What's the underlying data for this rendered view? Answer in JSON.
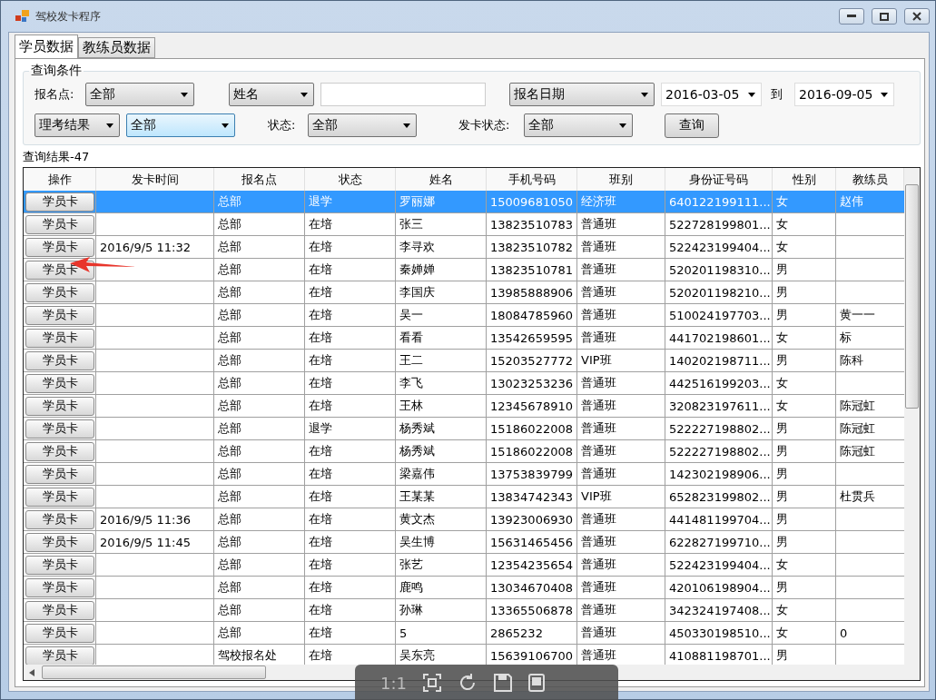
{
  "window": {
    "title": "驾校发卡程序"
  },
  "tabs": [
    {
      "label": "学员数据",
      "selected": true
    },
    {
      "label": "教练员数据",
      "selected": false
    }
  ],
  "query": {
    "title": "查询条件",
    "row1": [
      {
        "kind": "label",
        "text": "报名点:"
      },
      {
        "kind": "combo",
        "value": "全部",
        "focused": false
      },
      {
        "kind": "combo",
        "value": "姓名",
        "focused": false
      },
      {
        "kind": "field"
      },
      {
        "kind": "combo",
        "value": "报名日期",
        "focused": false
      },
      {
        "kind": "date",
        "value": "2016-03-05"
      },
      {
        "kind": "label",
        "text": "到"
      },
      {
        "kind": "date",
        "value": "2016-09-05"
      }
    ],
    "row2": [
      {
        "kind": "combo",
        "value": "理考结果",
        "focused": false
      },
      {
        "kind": "combo",
        "value": "全部",
        "focused": true
      },
      {
        "kind": "label",
        "text": "状态:"
      },
      {
        "kind": "combo",
        "value": "全部",
        "focused": false
      },
      {
        "kind": "label",
        "text": "发卡状态:"
      },
      {
        "kind": "combo",
        "value": "全部",
        "focused": false
      },
      {
        "kind": "button",
        "text": "查询"
      }
    ]
  },
  "results": {
    "title": "查询结果-47",
    "columns": [
      "操作",
      "发卡时间",
      "报名点",
      "状态",
      "姓名",
      "手机号码",
      "班别",
      "身份证号码",
      "性别",
      "教练员"
    ],
    "rows": [
      {
        "selected": true,
        "cells": [
          "学员卡",
          "",
          "总部",
          "退学",
          "罗丽娜",
          "15009681050",
          "经济班",
          "640122199111...",
          "女",
          "赵伟"
        ]
      },
      {
        "selected": false,
        "cells": [
          "学员卡",
          "",
          "总部",
          "在培",
          "张三",
          "13823510783",
          "普通班",
          "522728199801...",
          "女",
          ""
        ]
      },
      {
        "selected": false,
        "cells": [
          "学员卡",
          "2016/9/5 11:32",
          "总部",
          "在培",
          "李寻欢",
          "13823510782",
          "普通班",
          "522423199404...",
          "女",
          ""
        ]
      },
      {
        "selected": false,
        "cells": [
          "学员卡",
          "",
          "总部",
          "在培",
          "秦婵婵",
          "13823510781",
          "普通班",
          "520201198310...",
          "男",
          ""
        ]
      },
      {
        "selected": false,
        "cells": [
          "学员卡",
          "",
          "总部",
          "在培",
          "李国庆",
          "13985888906",
          "普通班",
          "520201198210...",
          "男",
          ""
        ]
      },
      {
        "selected": false,
        "cells": [
          "学员卡",
          "",
          "总部",
          "在培",
          "吴一",
          "18084785960",
          "普通班",
          "510024197703...",
          "男",
          "黄一一"
        ]
      },
      {
        "selected": false,
        "cells": [
          "学员卡",
          "",
          "总部",
          "在培",
          "看看",
          "13542659595",
          "普通班",
          "441702198601...",
          "女",
          "标"
        ]
      },
      {
        "selected": false,
        "cells": [
          "学员卡",
          "",
          "总部",
          "在培",
          "王二",
          "15203527772",
          "VIP班",
          "140202198711...",
          "男",
          "陈科"
        ]
      },
      {
        "selected": false,
        "cells": [
          "学员卡",
          "",
          "总部",
          "在培",
          "李飞",
          "13023253236",
          "普通班",
          "442516199203...",
          "女",
          ""
        ]
      },
      {
        "selected": false,
        "cells": [
          "学员卡",
          "",
          "总部",
          "在培",
          "王林",
          "12345678910",
          "普通班",
          "320823197611...",
          "女",
          "陈冠虹"
        ]
      },
      {
        "selected": false,
        "cells": [
          "学员卡",
          "",
          "总部",
          "退学",
          "杨秀斌",
          "15186022008",
          "普通班",
          "522227198802...",
          "男",
          "陈冠虹"
        ]
      },
      {
        "selected": false,
        "cells": [
          "学员卡",
          "",
          "总部",
          "在培",
          "杨秀斌",
          "15186022008",
          "普通班",
          "522227198802...",
          "男",
          "陈冠虹"
        ]
      },
      {
        "selected": false,
        "cells": [
          "学员卡",
          "",
          "总部",
          "在培",
          "梁嘉伟",
          "13753839799",
          "普通班",
          "142302198906...",
          "男",
          ""
        ]
      },
      {
        "selected": false,
        "cells": [
          "学员卡",
          "",
          "总部",
          "在培",
          "王某某",
          "13834742343",
          "VIP班",
          "652823199802...",
          "男",
          "杜贯兵"
        ]
      },
      {
        "selected": false,
        "cells": [
          "学员卡",
          "2016/9/5 11:36",
          "总部",
          "在培",
          "黄文杰",
          "13923006930",
          "普通班",
          "441481199704...",
          "男",
          ""
        ]
      },
      {
        "selected": false,
        "cells": [
          "学员卡",
          "2016/9/5 11:45",
          "总部",
          "在培",
          "吴生博",
          "15631465456",
          "普通班",
          "622827199710...",
          "男",
          ""
        ]
      },
      {
        "selected": false,
        "cells": [
          "学员卡",
          "",
          "总部",
          "在培",
          "张艺",
          "12354235654",
          "普通班",
          "522423199404...",
          "女",
          ""
        ]
      },
      {
        "selected": false,
        "cells": [
          "学员卡",
          "",
          "总部",
          "在培",
          "鹿鸣",
          "13034670408",
          "普通班",
          "420106198904...",
          "男",
          ""
        ]
      },
      {
        "selected": false,
        "cells": [
          "学员卡",
          "",
          "总部",
          "在培",
          "孙琳",
          "13365506878",
          "普通班",
          "342324197408...",
          "女",
          ""
        ]
      },
      {
        "selected": false,
        "cells": [
          "学员卡",
          "",
          "总部",
          "在培",
          "5",
          "2865232",
          "普通班",
          "450330198510...",
          "女",
          "0"
        ]
      },
      {
        "selected": false,
        "cells": [
          "学员卡",
          "",
          "驾校报名处",
          "在培",
          "吴东亮",
          "15639106700",
          "普通班",
          "410881198701...",
          "男",
          ""
        ]
      }
    ]
  },
  "viewer_toolbar": {
    "zoom_label": "1:1"
  }
}
